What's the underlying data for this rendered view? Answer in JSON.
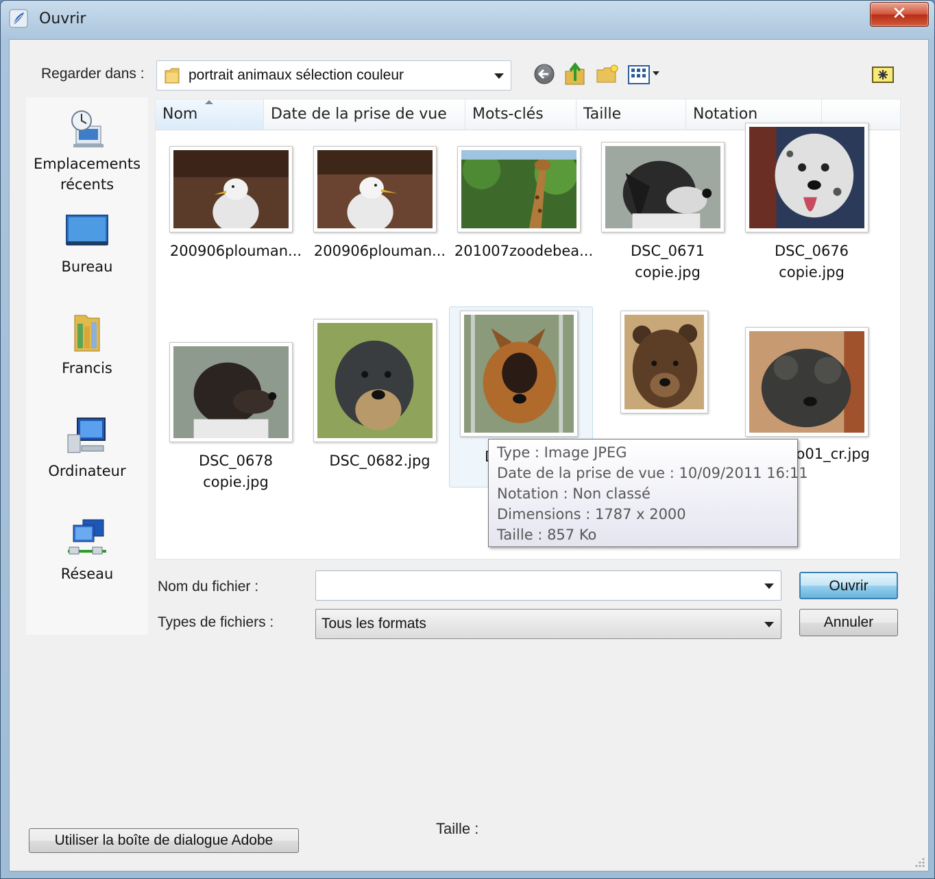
{
  "window": {
    "title": "Ouvrir",
    "close_glyph": "✕"
  },
  "toolbar": {
    "lookin_label": "Regarder dans :",
    "lookin_value": "portrait animaux sélection couleur"
  },
  "places": [
    {
      "label": "Emplacements récents",
      "icon": "recent-places-icon"
    },
    {
      "label": "Bureau",
      "icon": "desktop-icon"
    },
    {
      "label": "Francis",
      "icon": "user-folder-icon"
    },
    {
      "label": "Ordinateur",
      "icon": "computer-icon"
    },
    {
      "label": "Réseau",
      "icon": "network-icon"
    }
  ],
  "columns": [
    "Nom",
    "Date de la prise de vue",
    "Mots-clés",
    "Taille",
    "Notation"
  ],
  "files": [
    {
      "name": "200906plouman...",
      "subject": "seagull"
    },
    {
      "name": "200906plouman...",
      "subject": "seagull"
    },
    {
      "name": "201007zoodebea...",
      "subject": "giraffe"
    },
    {
      "name1": "DSC_0671",
      "name2": "copie.jpg",
      "subject": "dog"
    },
    {
      "name1": "DSC_0676",
      "name2": "copie.jpg",
      "subject": "dog"
    },
    {
      "name1": "DSC_0678",
      "name2": "copie.jpg",
      "subject": "dog"
    },
    {
      "name": "DSC_0682.jpg",
      "subject": "schnauzer"
    },
    {
      "name": "D",
      "subject": "german-shepherd"
    },
    {
      "name": "",
      "subject": "bear"
    },
    {
      "name": "o01_cr.jpg",
      "subject": "poodle"
    }
  ],
  "tooltip": {
    "type": "Type : Image JPEG",
    "date": "Date de la prise de vue : 10/09/2011 16:11",
    "rating": "Notation : Non classé",
    "dimensions": "Dimensions : 1787 x 2000",
    "size": "Taille : 857 Ko"
  },
  "form": {
    "filename_label": "Nom du fichier :",
    "filename_value": "",
    "filetype_label": "Types de fichiers :",
    "filetype_value": "Tous les formats"
  },
  "buttons": {
    "open": "Ouvrir",
    "cancel": "Annuler",
    "adobe": "Utiliser la boîte de dialogue Adobe"
  },
  "footer": {
    "size_label": "Taille :"
  },
  "colors": {
    "accent": "#3c7fb1",
    "title_bg": "#a9c4dc",
    "close": "#c8432a"
  }
}
